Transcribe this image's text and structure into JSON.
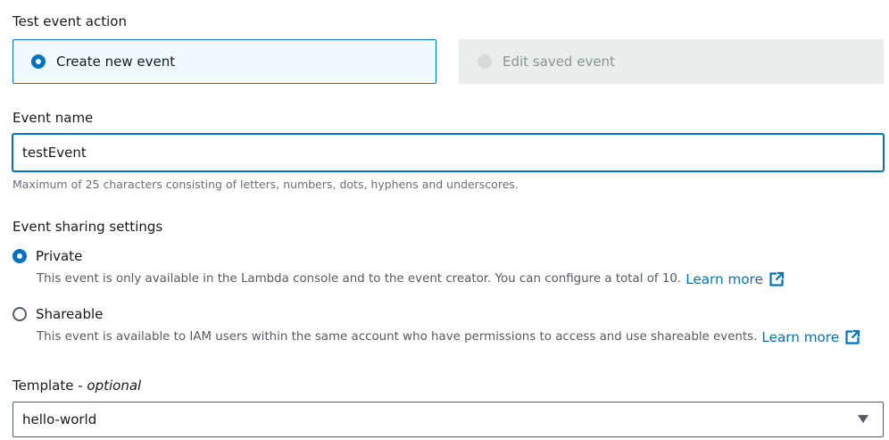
{
  "test_event_action": {
    "label": "Test event action",
    "options": [
      {
        "label": "Create new event",
        "selected": true,
        "disabled": false
      },
      {
        "label": "Edit saved event",
        "selected": false,
        "disabled": true
      }
    ]
  },
  "event_name": {
    "label": "Event name",
    "value": "testEvent",
    "hint": "Maximum of 25 characters consisting of letters, numbers, dots, hyphens and underscores."
  },
  "sharing": {
    "label": "Event sharing settings",
    "options": [
      {
        "label": "Private",
        "selected": true,
        "description": "This event is only available in the Lambda console and to the event creator. You can configure a total of 10.",
        "link": "Learn more"
      },
      {
        "label": "Shareable",
        "selected": false,
        "description": "This event is available to IAM users within the same account who have permissions to access and use shareable events.",
        "link": "Learn more"
      }
    ]
  },
  "template": {
    "label": "Template - ",
    "label_optional": "optional",
    "value": "hello-world"
  },
  "icons": {
    "external_link": "external-link-icon",
    "dropdown": "caret-down-icon"
  },
  "colors": {
    "accent": "#0073bb",
    "selected_tile_bg": "#f1faff",
    "disabled_tile_bg": "#eaeded",
    "text": "#16191f",
    "secondary_text": "#545b64"
  }
}
